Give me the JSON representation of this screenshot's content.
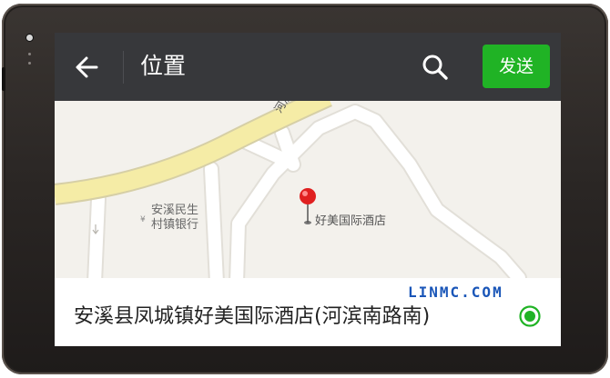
{
  "header": {
    "title": "位置",
    "send_label": "发送"
  },
  "map": {
    "road_label": "河滨",
    "bank_label_line1": "安溪民生",
    "bank_label_line2": "村镇银行",
    "poi_label": "好美国际酒店"
  },
  "location": {
    "address": "安溪县凤城镇好美国际酒店(河滨南路南)",
    "selected": true
  },
  "watermark": "LINMC.COM",
  "colors": {
    "topbar": "#37383b",
    "send_button": "#20b325",
    "pin": "#e02020",
    "selected_radio": "#20b325"
  },
  "icons": [
    "back-arrow-icon",
    "search-icon",
    "location-pin-icon",
    "radio-selected-icon"
  ]
}
